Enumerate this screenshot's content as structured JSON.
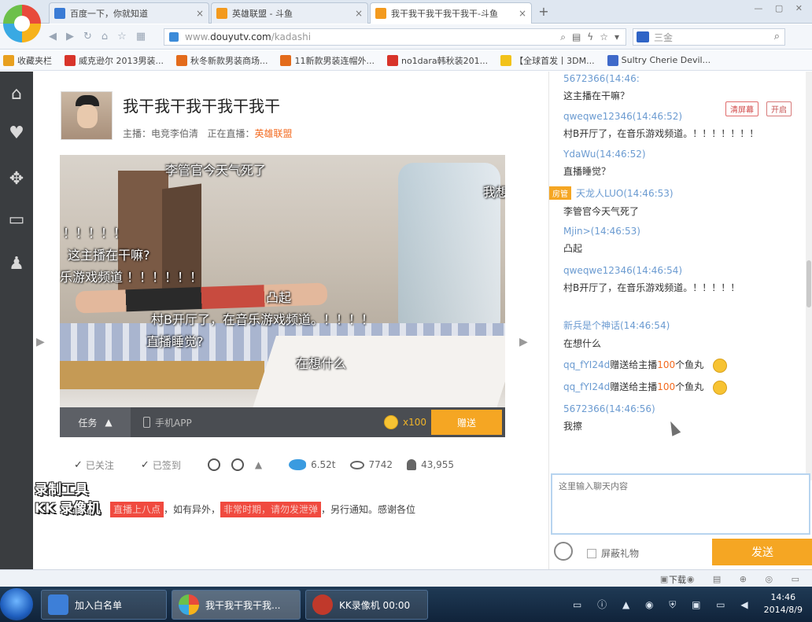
{
  "browser": {
    "tabs": [
      {
        "label": "百度一下，你就知道",
        "close": "×"
      },
      {
        "label": "英雄联盟 - 斗鱼",
        "close": "×"
      },
      {
        "label": "我干我干我干我干我干-斗鱼",
        "close": "×"
      }
    ],
    "new_tab": "+",
    "url_prefix": "www.",
    "url_domain": "douyutv.com",
    "url_path": "/kadashi",
    "search_placeholder": "三金",
    "bookmarks": [
      {
        "label": "收藏夹栏",
        "color": "#e8a020"
      },
      {
        "label": "威克逊尔 2013男装...",
        "color": "#d8342a"
      },
      {
        "label": "秋冬新款男装商场...",
        "color": "#e36b1c"
      },
      {
        "label": "11新款男装连帽外...",
        "color": "#e36b1c"
      },
      {
        "label": "no1dara韩秋装201...",
        "color": "#d8342a"
      },
      {
        "label": "【全球首发丨3DM...",
        "color": "#f2c21a"
      },
      {
        "label": "Sultry Cherie Devil...",
        "color": "#3f69c9"
      }
    ]
  },
  "room": {
    "title": "我干我干我干我干我干",
    "host_label": "主播：",
    "host_name": "电竞李伯清",
    "live_label": "正在直播：",
    "category": "英雄联盟"
  },
  "danmu": [
    "李管官今天气死了",
    "我想",
    "！！！！！",
    "这主播在干嘛?",
    "乐游戏频道  ！！！！！！",
    "凸起",
    "村B开厅了，在音乐游戏频道。！！！！",
    "直播睡觉?",
    "在想什么"
  ],
  "player": {
    "task_label": "任务",
    "task_arrow": "▲",
    "app_label": "手机APP",
    "coin_count": "x100",
    "send_gift": "赠送"
  },
  "actions": {
    "followed": "已关注",
    "signed": "已签到",
    "fish_value": "6.52t",
    "views": "7742",
    "followers": "43,955",
    "more": "▲"
  },
  "notice": {
    "hl1": "直播上八点",
    "t1": "，如有异外，",
    "hl2": "非常时期，请勿发泄弹",
    "t2": "，另行通知。感谢各位"
  },
  "watermark": [
    "录制工具",
    "KK 录像机"
  ],
  "chat": {
    "messages": [
      {
        "nick": "5672366(14:46:",
        "text": "这主播在干嘛？"
      },
      {
        "nick": "qweqwe12346(14:46:52)",
        "text": "村B开厅了，在音乐游戏频道。！！！！！！！"
      },
      {
        "nick": "YdaWu(14:46:52)",
        "text": "直播睡觉？"
      },
      {
        "nick": "天龙人LUO(14:46:53)",
        "text": "李管官今天气死了",
        "badge": "房管"
      },
      {
        "nick": "Mjin>(14:46:53)",
        "text": "凸起"
      },
      {
        "nick": "qweqwe12346(14:46:54)",
        "text": "村B开厅了，在音乐游戏频道。！！！！！"
      },
      {
        "nick": "新兵是个神话(14:46:54)",
        "text": "在想什么"
      }
    ],
    "gifts": [
      {
        "nick": "qq_fYI24d",
        "t1": "赠送给主播",
        "num": "100",
        "t2": "个鱼丸"
      },
      {
        "nick": "qq_fYI24d",
        "t1": "赠送给主播",
        "num": "100",
        "t2": "个鱼丸"
      }
    ],
    "last_message": {
      "nick": "5672366(14:46:56)",
      "text": "我擦"
    },
    "tool_1": "清屏幕",
    "tool_2": "开启",
    "input_placeholder": "这里输入聊天内容",
    "block_gift": "屏蔽礼物",
    "send": "发送"
  },
  "statusbar": {
    "download": "下载"
  },
  "taskbar": {
    "items": [
      {
        "label": "加入白名单"
      },
      {
        "label": "我干我干我干我..."
      },
      {
        "label": "KK录像机 00:00"
      }
    ],
    "time": "14:46",
    "date": "2014/8/9"
  }
}
